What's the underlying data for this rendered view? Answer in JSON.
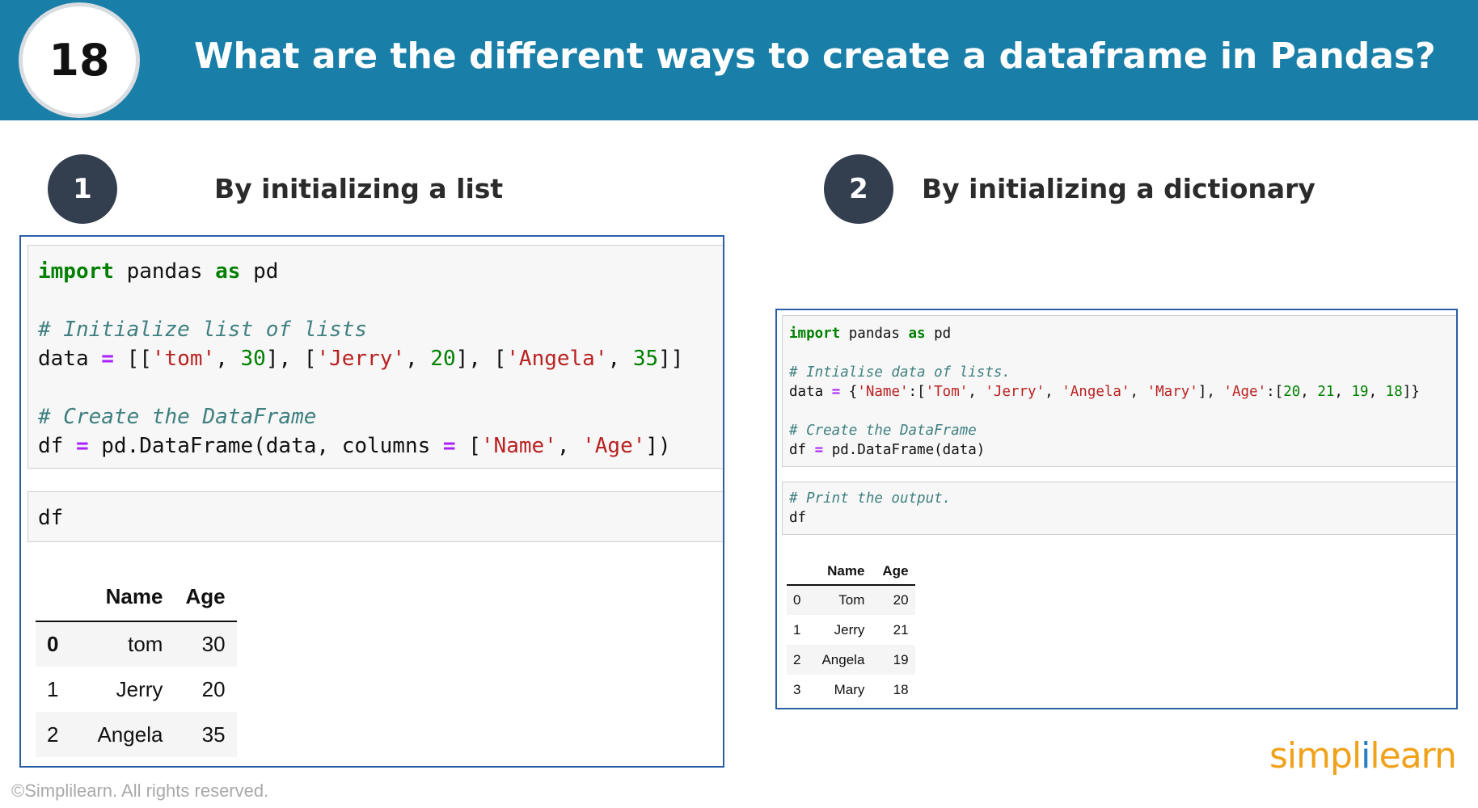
{
  "header": {
    "number": "18",
    "title": "What are the different ways to create a dataframe in Pandas?"
  },
  "section1": {
    "number": "1",
    "title": "By initializing a list",
    "code1": {
      "l1": {
        "kw1": "import",
        "t1": " pandas ",
        "kw2": "as",
        "t2": " pd"
      },
      "comment1": "# Initialize list of lists",
      "l3": {
        "a": "data ",
        "op": "=",
        "b": " [[",
        "s1": "'tom'",
        "c1": ", ",
        "n1": "30",
        "d1": "], [",
        "s2": "'Jerry'",
        "c2": ", ",
        "n2": "20",
        "d2": "], [",
        "s3": "'Angela'",
        "c3": ", ",
        "n3": "35",
        "e": "]]"
      },
      "comment2": "# Create the DataFrame",
      "l5": {
        "a": "df ",
        "op1": "=",
        "b": " pd.DataFrame(data, columns ",
        "op2": "=",
        "c": " [",
        "s1": "'Name'",
        "d": ", ",
        "s2": "'Age'",
        "e": "])"
      }
    },
    "code2": "df",
    "table": {
      "columns": [
        "",
        "Name",
        "Age"
      ],
      "rows": [
        [
          "0",
          "tom",
          "30"
        ],
        [
          "1",
          "Jerry",
          "20"
        ],
        [
          "2",
          "Angela",
          "35"
        ]
      ]
    }
  },
  "section2": {
    "number": "2",
    "title": "By initializing a dictionary",
    "code1": {
      "l1": {
        "kw1": "import",
        "t1": " pandas ",
        "kw2": "as",
        "t2": " pd"
      },
      "comment1": "# Intialise data of lists.",
      "l3": {
        "a": "data ",
        "op": "=",
        "b": " {",
        "k1": "'Name'",
        "c1": ":[",
        "s1": "'Tom'",
        "x1": ", ",
        "s2": "'Jerry'",
        "x2": ", ",
        "s3": "'Angela'",
        "x3": ", ",
        "s4": "'Mary'",
        "c2": "], ",
        "k2": "'Age'",
        "c3": ":[",
        "n1": "20",
        "y1": ", ",
        "n2": "21",
        "y2": ", ",
        "n3": "19",
        "y3": ", ",
        "n4": "18",
        "e": "]}"
      },
      "comment2": "# Create the DataFrame",
      "l5": {
        "a": "df ",
        "op": "=",
        "b": " pd.DataFrame(data)"
      }
    },
    "code2": {
      "comment": "# Print the output.",
      "l2": "df"
    },
    "table": {
      "columns": [
        "",
        "Name",
        "Age"
      ],
      "rows": [
        [
          "0",
          "Tom",
          "20"
        ],
        [
          "1",
          "Jerry",
          "21"
        ],
        [
          "2",
          "Angela",
          "19"
        ],
        [
          "3",
          "Mary",
          "18"
        ]
      ]
    }
  },
  "footer": {
    "copyright": "©Simplilearn. All rights reserved."
  },
  "logo": {
    "part1": "simpl",
    "part2": "i",
    "part3": "learn"
  }
}
